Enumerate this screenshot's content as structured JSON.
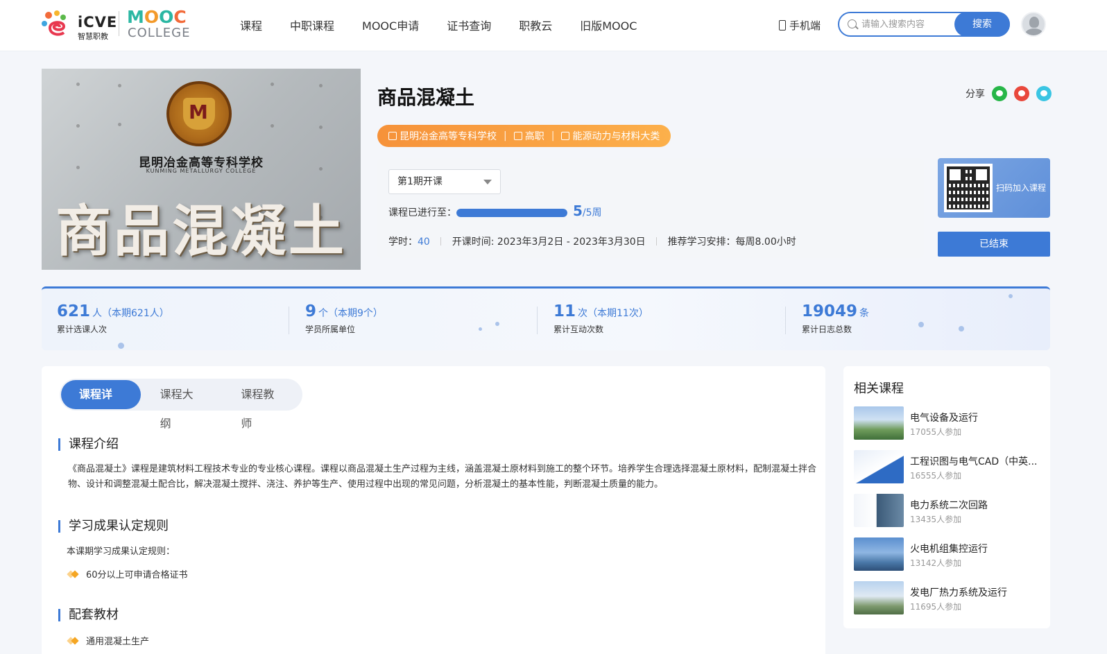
{
  "brand": {
    "icve_title": "iCVE",
    "icve_sub": "智慧职教",
    "mooc_title": "MOOC",
    "mooc_sub": "COLLEGE"
  },
  "nav": [
    "课程",
    "中职课程",
    "MOOC申请",
    "证书查询",
    "职教云",
    "旧版MOOC"
  ],
  "header": {
    "mobile_label": "手机端",
    "search_placeholder": "请输入搜索内容",
    "search_button": "搜索"
  },
  "course": {
    "cover": {
      "school_cn": "昆明冶金高等专科学校",
      "school_en": "KUNMING METALLURGY COLLEGE",
      "big_title": "商品混凝土"
    },
    "title": "商品混凝土",
    "share_label": "分享",
    "tags": [
      "昆明冶金高等专科学校",
      "高职",
      "能源动力与材料大类"
    ],
    "term": "第1期开课",
    "progress_label": "课程已进行至：",
    "progress_current": "5",
    "progress_total": "/5周",
    "progress_fraction": 1.0,
    "hours_label": "学时：",
    "hours_value": "40",
    "schedule": "开课时间: 2023年3月2日 - 2023年3月30日",
    "study_plan": "推荐学习安排：每周8.00小时",
    "qr_text": "扫码加入课程",
    "status_button": "已结束"
  },
  "stats": [
    {
      "num": "621",
      "unit": "人（本期621人）",
      "label": "累计选课人次"
    },
    {
      "num": "9",
      "unit": "个（本期9个）",
      "label": "学员所属单位"
    },
    {
      "num": "11",
      "unit": "次（本期11次）",
      "label": "累计互动次数"
    },
    {
      "num": "19049",
      "unit": "条",
      "label": "累计日志总数"
    }
  ],
  "tabs": [
    "课程详情",
    "课程大纲",
    "课程教师"
  ],
  "detail": {
    "intro_title": "课程介绍",
    "intro_text": "《商品混凝土》课程是建筑材料工程技术专业的专业核心课程。课程以商品混凝土生产过程为主线，涵盖混凝土原材料到施工的整个环节。培养学生合理选择混凝土原材料，配制混凝土拌合物、设计和调整混凝土配合比，解决混凝土搅拌、浇注、养护等生产、使用过程中出现的常见问题，分析混凝土的基本性能，判断混凝土质量的能力。",
    "rules_title": "学习成果认定规则",
    "rules_lead": "本课期学习成果认定规则：",
    "rules_item": "60分以上可申请合格证书",
    "books_title": "配套教材",
    "books_item": "通用混凝土生产"
  },
  "related": {
    "title": "相关课程",
    "items": [
      {
        "name": "电气设备及运行",
        "count": "17055人参加"
      },
      {
        "name": "工程识图与电气CAD（中英...",
        "count": "16555人参加"
      },
      {
        "name": "电力系统二次回路",
        "count": "13435人参加"
      },
      {
        "name": "火电机组集控运行",
        "count": "13142人参加"
      },
      {
        "name": "发电厂热力系统及运行",
        "count": "11695人参加"
      }
    ]
  },
  "colors": {
    "accent": "#3d7ad6",
    "tag_orange": "#f6923a",
    "mooc_orange": "#f39a2b",
    "mooc_teal": "#2bb7a3"
  }
}
